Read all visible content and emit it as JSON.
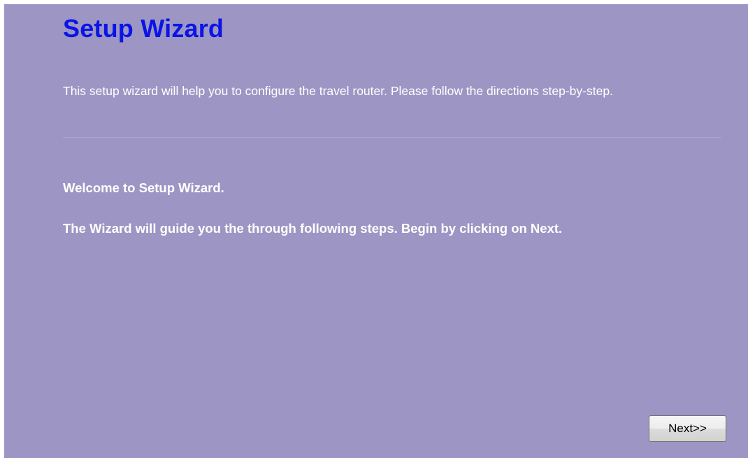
{
  "page": {
    "title": "Setup Wizard",
    "intro": "This setup wizard will help you to configure the travel router. Please follow the directions step-by-step.",
    "welcome": "Welcome to Setup Wizard.",
    "guide": "The Wizard will guide you the through following steps. Begin by clicking on Next."
  },
  "buttons": {
    "next_label": "Next>>"
  },
  "colors": {
    "background": "#9d96c4",
    "title": "#0a14e6",
    "body_text": "#ffffff"
  }
}
